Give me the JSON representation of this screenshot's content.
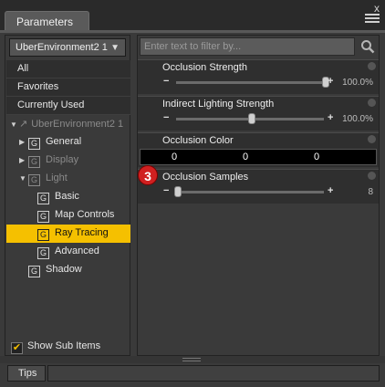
{
  "window": {
    "tab_label": "Parameters",
    "close_glyph": "x"
  },
  "left_panel": {
    "dropdown_value": "UberEnvironment2 1",
    "categories": [
      "All",
      "Favorites",
      "Currently Used"
    ],
    "tree": {
      "root": "UberEnvironment2 1",
      "general": "General",
      "display": "Display",
      "light": "Light",
      "basic": "Basic",
      "map_controls": "Map Controls",
      "ray_tracing": "Ray Tracing",
      "advanced": "Advanced",
      "shadow": "Shadow"
    },
    "show_sub_items": "Show Sub Items",
    "show_sub_items_checked": true
  },
  "right_panel": {
    "filter_placeholder": "Enter text to filter by...",
    "params": [
      {
        "label": "Occlusion Strength",
        "value": "100.0%",
        "fraction": 1.0
      },
      {
        "label": "Indirect Lighting Strength",
        "value": "100.0%",
        "fraction": 0.5
      },
      {
        "label": "Occlusion Color",
        "rgb": [
          "0",
          "0",
          "0"
        ]
      },
      {
        "label": "Occlusion Samples",
        "value": "8",
        "fraction": 0.0
      }
    ]
  },
  "annotation": {
    "badge_number": "3",
    "color": "#d02020"
  },
  "bottom": {
    "tips_tab": "Tips"
  },
  "colors": {
    "selected": "#f5c000",
    "panel": "#3a3a3a"
  }
}
